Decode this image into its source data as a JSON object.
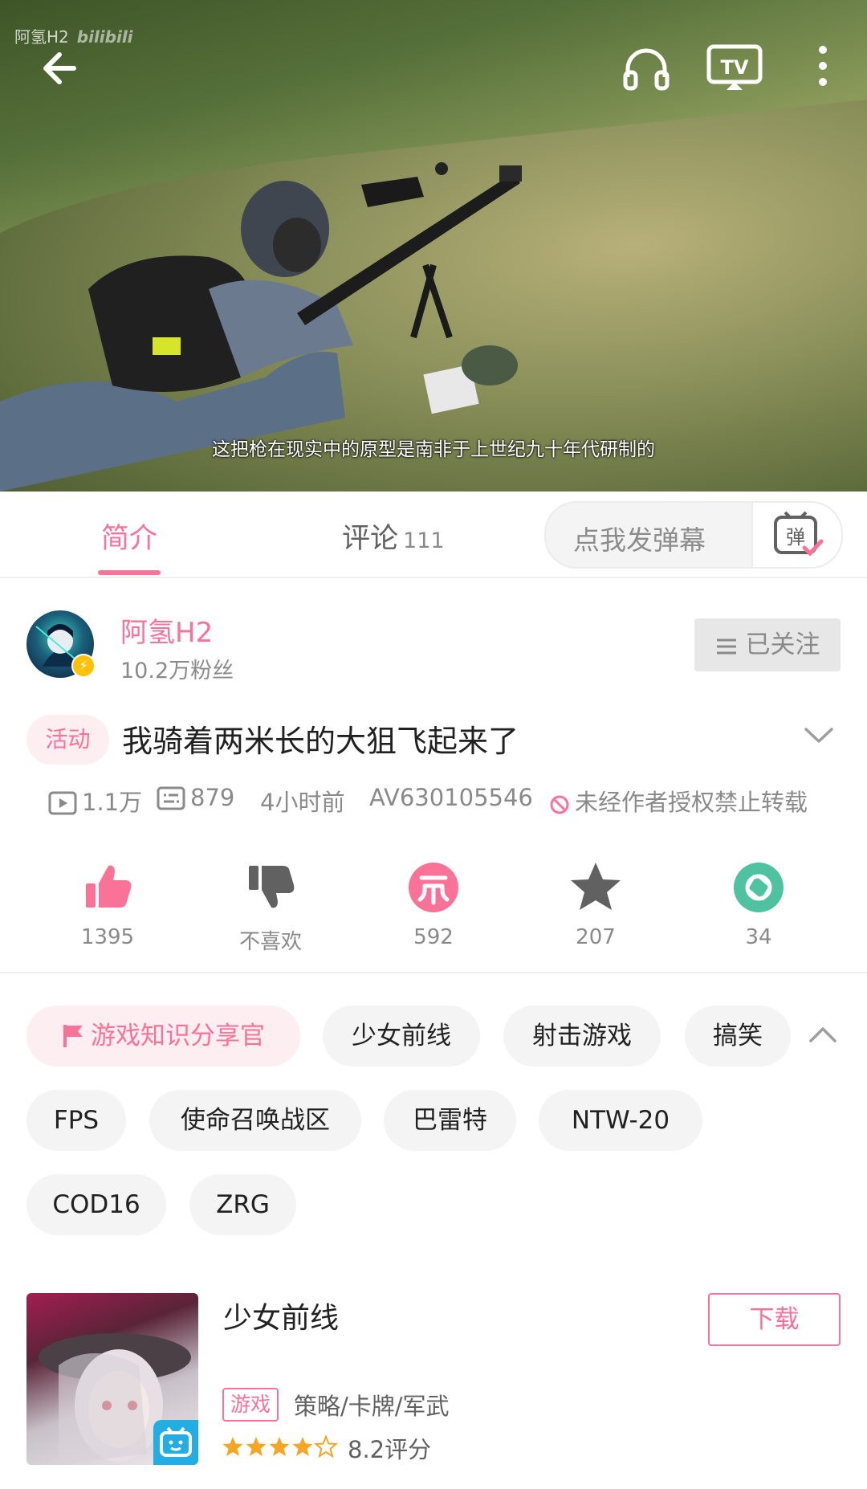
{
  "player": {
    "watermark": "阿氢H2",
    "watermark_logo": "bilibili",
    "subtitle": "这把枪在现实中的原型是南非于上世纪九十年代研制的",
    "icons": [
      "back-arrow-icon",
      "headphones-icon",
      "tv-cast-icon",
      "more-vertical-icon"
    ]
  },
  "tabs": {
    "intro": "简介",
    "comments": "评论",
    "comments_count": "111",
    "danmaku_placeholder": "点我发弹幕",
    "danmaku_icon_text": "弹"
  },
  "uploader": {
    "name": "阿氢H2",
    "fans": "10.2万粉丝",
    "follow_label": "已关注"
  },
  "video": {
    "activity_tag": "活动",
    "title": "我骑着两米长的大狙飞起来了",
    "views": "1.1万",
    "danmaku_count": "879",
    "time": "4小时前",
    "av": "AV630105546",
    "repost_notice": "未经作者授权禁止转载"
  },
  "actions": {
    "like": "1395",
    "dislike": "不喜欢",
    "coin": "592",
    "favorite": "207",
    "share": "34"
  },
  "tags": {
    "row1": [
      "游戏知识分享官",
      "少女前线",
      "射击游戏",
      "搞笑"
    ],
    "row2": [
      "FPS",
      "使命召唤战区",
      "巴雷特",
      "NTW-20"
    ],
    "row3": [
      "COD16",
      "ZRG"
    ]
  },
  "game": {
    "name": "少女前线",
    "download": "下载",
    "type_tag": "游戏",
    "genre": "策略/卡牌/军武",
    "rating_text": "8.2评分",
    "stars": 4
  },
  "colors": {
    "accent": "#fb7299",
    "share_green": "#4fc3a1",
    "muted": "#8a8a8a"
  }
}
